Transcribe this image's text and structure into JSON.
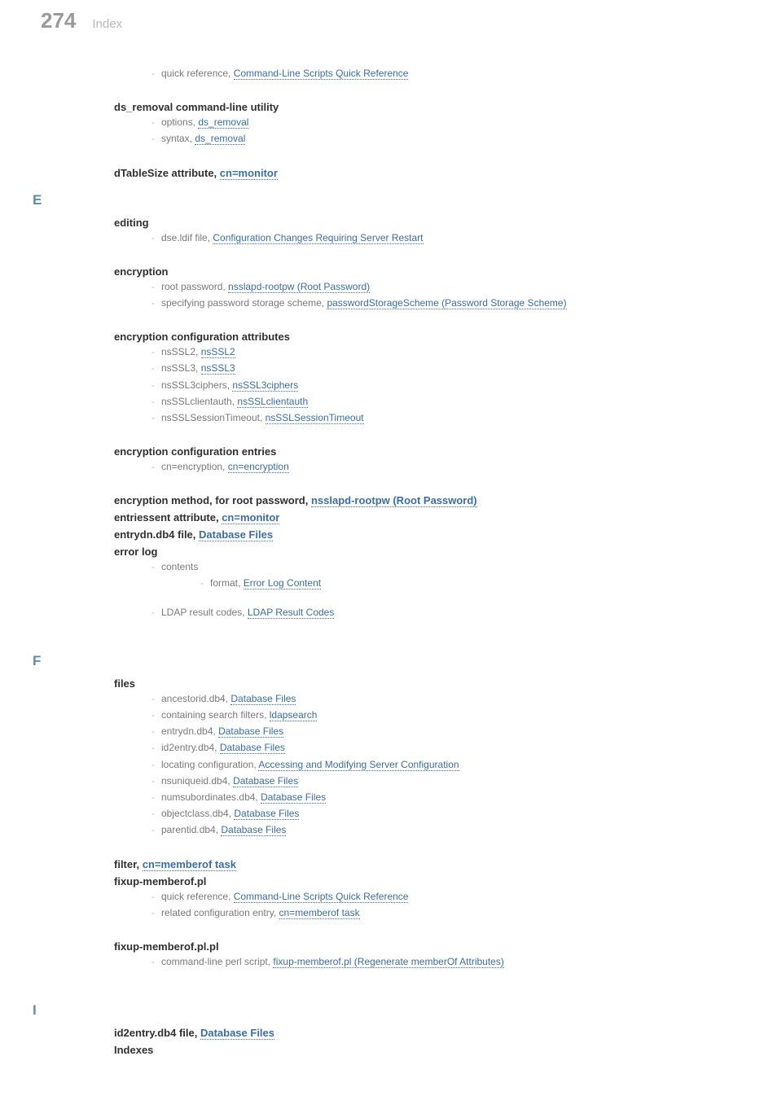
{
  "header": {
    "page_number": "274",
    "title": "Index"
  },
  "quick_ref": {
    "label": "quick reference, ",
    "link": "Command-Line Scripts Quick Reference"
  },
  "ds_removal": {
    "title": "ds_removal command-line utility",
    "opt_label": "options, ",
    "opt_link": "ds_removal",
    "syn_label": "syntax, ",
    "syn_link": "ds_removal"
  },
  "dTableSize": {
    "title": "dTableSize attribute, ",
    "link": "cn=monitor"
  },
  "letters": {
    "E": "E",
    "F": "F",
    "I": "I"
  },
  "editing": {
    "title": "editing",
    "item_label": "dse.ldif file, ",
    "item_link": "Configuration Changes Requiring Server Restart"
  },
  "encryption": {
    "title": "encryption",
    "root_label": "root password, ",
    "root_link": "nsslapd-rootpw (Root Password)",
    "scheme_label": "specifying password storage scheme, ",
    "scheme_link": "passwordStorageScheme (Password Storage Scheme)"
  },
  "enc_attrs": {
    "title": "encryption configuration attributes",
    "i1_label": "nsSSL2, ",
    "i1_link": "nsSSL2",
    "i2_label": "nsSSL3, ",
    "i2_link": "nsSSL3",
    "i3_label": "nsSSL3ciphers, ",
    "i3_link": "nsSSL3ciphers",
    "i4_label": "nsSSLclientauth, ",
    "i4_link": "nsSSLclientauth",
    "i5_label": "nsSSLSessionTimeout, ",
    "i5_link": "nsSSLSessionTimeout"
  },
  "enc_entries": {
    "title": "encryption configuration entries",
    "i1_label": "cn=encryption, ",
    "i1_link": "cn=encryption"
  },
  "enc_method": {
    "title": "encryption method, for root password, ",
    "link": "nsslapd-rootpw (Root Password)"
  },
  "entriessent": {
    "title": "entriessent attribute, ",
    "link": "cn=monitor"
  },
  "entrydn": {
    "title": "entrydn.db4 file, ",
    "link": "Database Files"
  },
  "errorlog": {
    "title": "error log",
    "contents_label": "contents",
    "format_label": "format, ",
    "format_link": "Error Log Content",
    "ldap_label": "LDAP result codes, ",
    "ldap_link": "LDAP Result Codes"
  },
  "files": {
    "title": "files",
    "i1_label": "ancestorid.db4, ",
    "i1_link": "Database Files",
    "i2_label": "containing search filters, ",
    "i2_link": "ldapsearch",
    "i3_label": "entrydn.db4, ",
    "i3_link": "Database Files",
    "i4_label": "id2entry.db4, ",
    "i4_link": "Database Files",
    "i5_label": "locating configuration, ",
    "i5_link": "Accessing and Modifying Server Configuration",
    "i6_label": "nsuniqueid.db4, ",
    "i6_link": "Database Files",
    "i7_label": "numsubordinates.db4, ",
    "i7_link": "Database Files",
    "i8_label": "objectclass.db4, ",
    "i8_link": "Database Files",
    "i9_label": "parentid.db4, ",
    "i9_link": "Database Files"
  },
  "filter": {
    "title": "filter, ",
    "link": "cn=memberof task"
  },
  "fixup": {
    "title": "fixup-memberof.pl",
    "i1_label": "quick reference, ",
    "i1_link": "Command-Line Scripts Quick Reference",
    "i2_label": "related configuration entry, ",
    "i2_link": "cn=memberof task"
  },
  "fixup_plpl": {
    "title": "fixup-memberof.pl.pl",
    "i1_label": "command-line perl script, ",
    "i1_link": "fixup-memberof.pl (Regenerate memberOf Attributes)"
  },
  "id2entry": {
    "title": "id2entry.db4 file, ",
    "link": "Database Files"
  },
  "indexes": {
    "title": "Indexes"
  }
}
